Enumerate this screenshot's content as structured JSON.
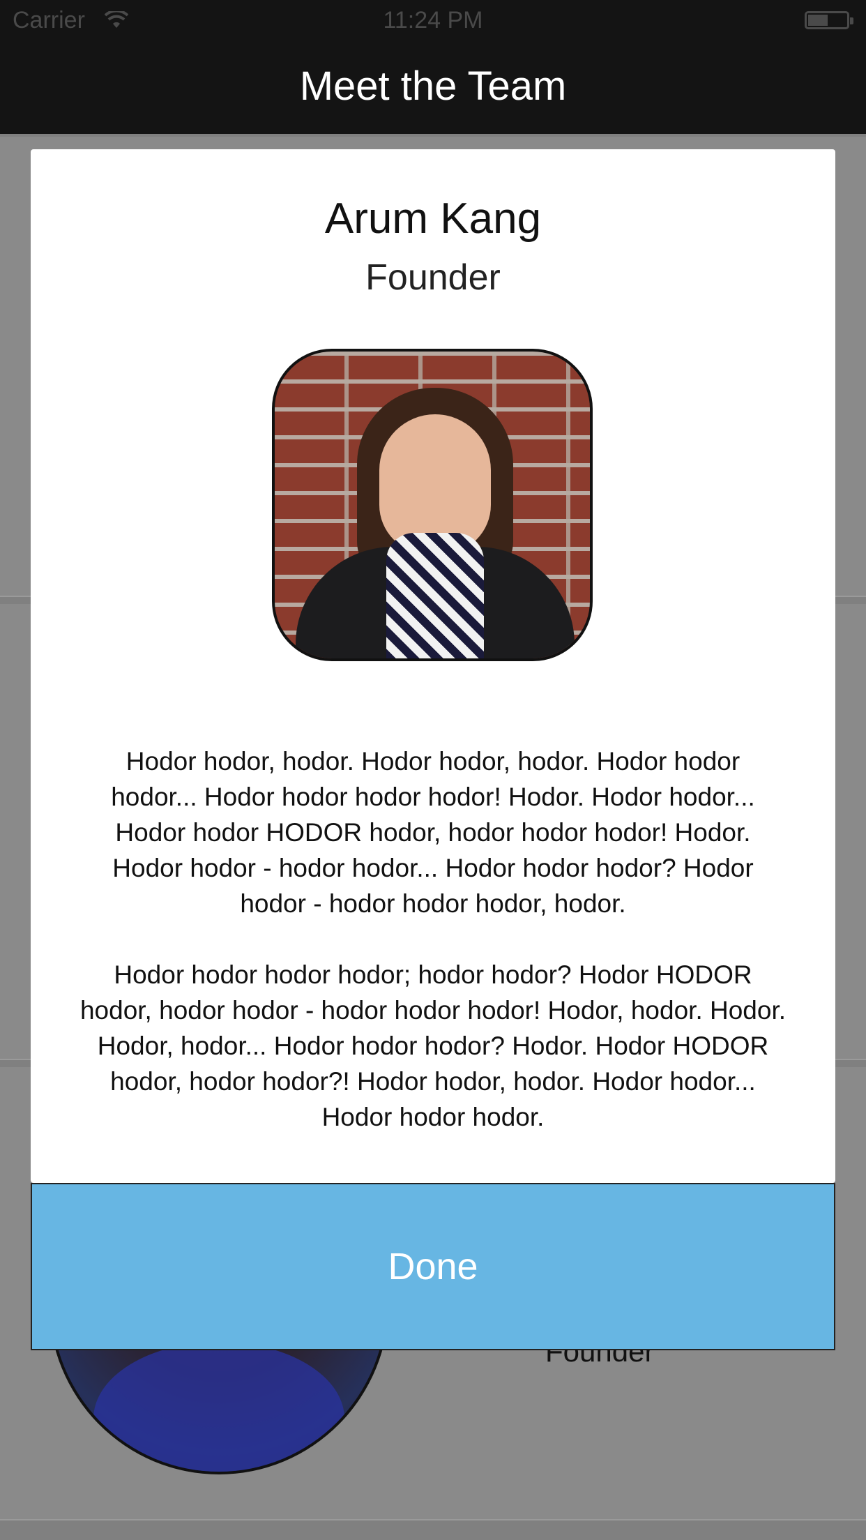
{
  "status_bar": {
    "carrier": "Carrier",
    "time": "11:24 PM"
  },
  "nav": {
    "title": "Meet the Team"
  },
  "background": {
    "visible_role": "Founder"
  },
  "modal": {
    "name": "Arum Kang",
    "role": "Founder",
    "photo_alt": "Portrait photo of Arum Kang",
    "bio_paragraphs": [
      "Hodor hodor, hodor. Hodor hodor, hodor. Hodor hodor hodor... Hodor hodor hodor hodor! Hodor. Hodor hodor... Hodor hodor HODOR hodor, hodor hodor hodor! Hodor. Hodor hodor - hodor hodor... Hodor hodor hodor? Hodor hodor - hodor hodor hodor, hodor.",
      "Hodor hodor hodor hodor; hodor hodor? Hodor HODOR hodor, hodor hodor - hodor hodor hodor! Hodor, hodor. Hodor. Hodor, hodor... Hodor hodor hodor? Hodor. Hodor HODOR hodor, hodor hodor?! Hodor hodor, hodor. Hodor hodor... Hodor hodor hodor."
    ],
    "done_label": "Done"
  },
  "colors": {
    "nav_background": "#141414",
    "done_button": "#67b6e3",
    "overlay": "#808080"
  }
}
